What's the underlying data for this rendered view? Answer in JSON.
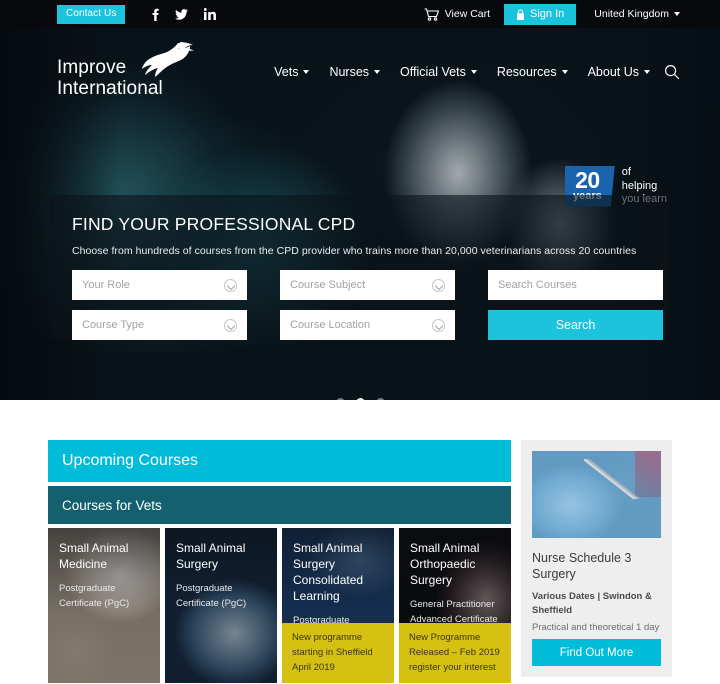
{
  "topbar": {
    "contact_label": "Contact Us",
    "socials": [
      {
        "name": "facebook-icon",
        "label": "f"
      },
      {
        "name": "twitter-icon",
        "label": "t"
      },
      {
        "name": "linkedin-icon",
        "label": "in"
      }
    ],
    "cart_label": "View Cart",
    "signin_label": "Sign In",
    "country_label": "United Kingdom"
  },
  "header": {
    "logo_text": "Improve\nInternational",
    "nav": [
      {
        "label": "Vets"
      },
      {
        "label": "Nurses"
      },
      {
        "label": "Official Vets"
      },
      {
        "label": "Resources"
      },
      {
        "label": "About Us"
      }
    ]
  },
  "hero": {
    "badge": {
      "number": "20",
      "years": "years",
      "text": "of\nhelping\nyou learn"
    },
    "panel": {
      "title": "FIND YOUR PROFESSIONAL CPD",
      "subtitle": "Choose from hundreds of courses from the CPD provider who trains more than 20,000 veterinarians across 20 countries",
      "fields": [
        {
          "name": "role-select",
          "placeholder": "Your Role"
        },
        {
          "name": "subject-select",
          "placeholder": "Course Subject"
        },
        {
          "name": "search-courses-input",
          "placeholder": "Search Courses"
        },
        {
          "name": "course-type-select",
          "placeholder": "Course Type"
        },
        {
          "name": "course-location-select",
          "placeholder": "Course Location"
        }
      ],
      "search_label": "Search"
    },
    "carousel": {
      "total": 3,
      "active": 2
    }
  },
  "main": {
    "upcoming_header": "Upcoming Courses",
    "vets_header": "Courses for Vets",
    "cards": [
      {
        "title": "Small Animal Medicine",
        "subtitle": "Postgraduate Certificate (PgC)",
        "banner": ""
      },
      {
        "title": "Small Animal Surgery",
        "subtitle": "Postgraduate Certificate (PgC)",
        "banner": ""
      },
      {
        "title": "Small Animal Surgery Consolidated Learning",
        "subtitle": "Postgraduate Certificate (PgC)",
        "banner": "New programme starting in Sheffield April 2019"
      },
      {
        "title": "Small Animal Orthopaedic Surgery",
        "subtitle": "General Practitioner Advanced Certificate",
        "banner": "New Programme Released – Feb 2019 register your interest"
      }
    ],
    "promo": {
      "title": "Nurse Schedule 3 Surgery",
      "meta": "Various Dates | Swindon & Sheffield",
      "description": "Practical and theoretical 1 day course",
      "button_label": "Find Out More"
    }
  },
  "colors": {
    "accent_cyan": "#1bc3dd",
    "header_cyan": "#00bcd9",
    "teal_dark": "#15606e",
    "badge_blue": "#1a63ad",
    "banner_yellow": "#d6c112",
    "topbar_black": "#07090d"
  }
}
